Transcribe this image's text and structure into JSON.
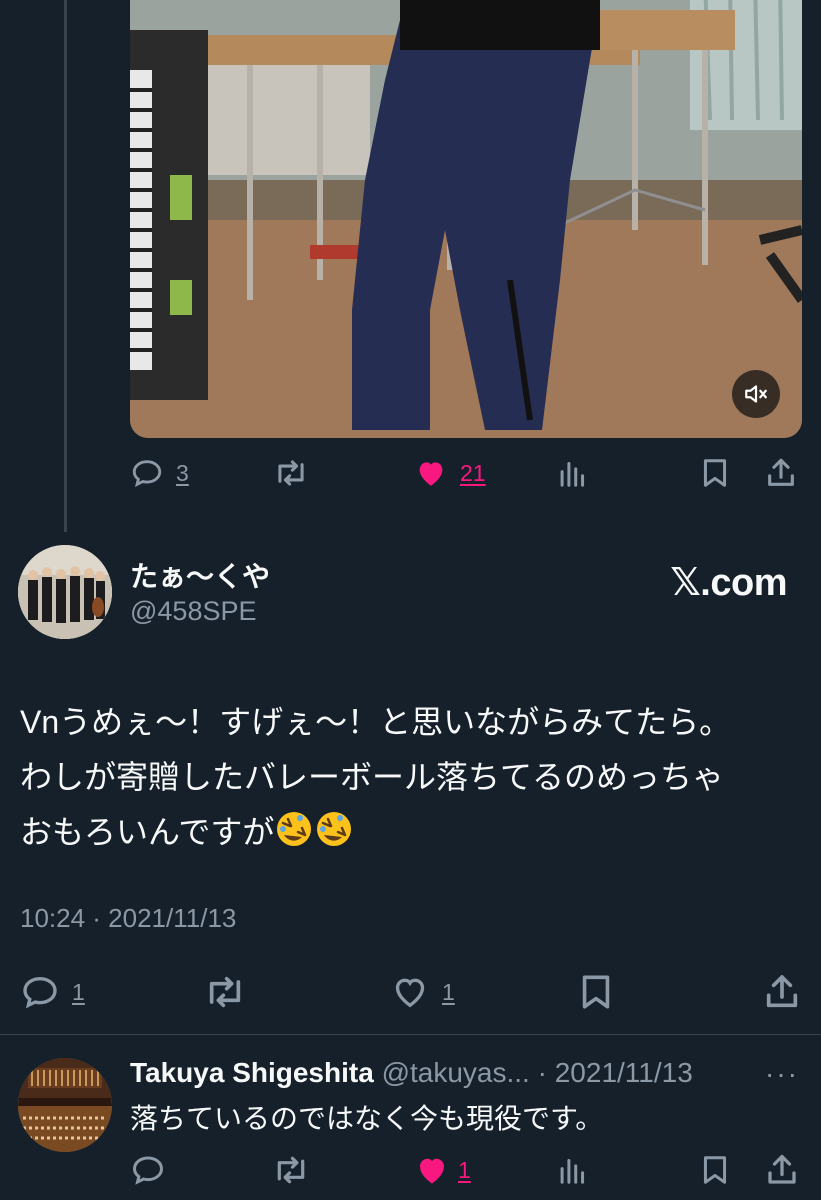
{
  "quoted_tweet": {
    "media": {
      "mute_icon": "speaker-muted-icon"
    },
    "actions": {
      "reply_count": "3",
      "like_count": "21",
      "liked": true
    }
  },
  "tweet": {
    "display_name": "たぁ〜くや",
    "handle": "@458SPE",
    "source_label": "𝕏.com",
    "text_line1": "Vnうめぇ〜！すげぇ〜！と思いながらみてたら。",
    "text_line2": "わしが寄贈したバレーボール落ちてるのめっちゃ",
    "text_line3": "おもろいんですが",
    "emoji": [
      "rolling-on-floor-laughing",
      "rolling-on-floor-laughing"
    ],
    "timestamp": "10:24 · 2021/11/13",
    "actions": {
      "reply_count": "1",
      "like_count": "1"
    }
  },
  "reply": {
    "display_name": "Takuya Shigeshita",
    "handle": "@takuyas...",
    "date": "· 2021/11/13",
    "more": "···",
    "text": "落ちているのではなく今も現役です。",
    "actions": {
      "like_count": "1",
      "liked": true
    }
  },
  "colors": {
    "background": "#15202b",
    "secondary_text": "#8b98a5",
    "like_pink": "#f91880",
    "divider": "#38444d"
  }
}
